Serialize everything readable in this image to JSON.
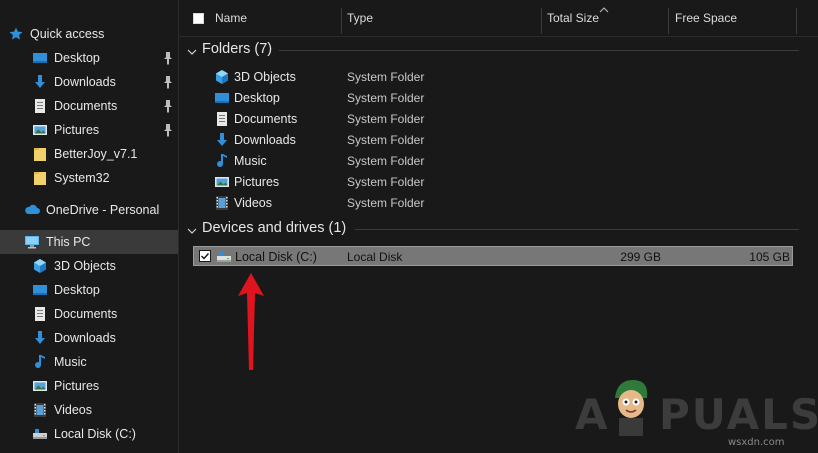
{
  "sidebar": {
    "quick_access": "Quick access",
    "quick_items": [
      {
        "label": "Desktop",
        "icon": "desktop-icon",
        "pinned": true
      },
      {
        "label": "Downloads",
        "icon": "downloads-icon",
        "pinned": true
      },
      {
        "label": "Documents",
        "icon": "documents-icon",
        "pinned": true
      },
      {
        "label": "Pictures",
        "icon": "pictures-icon",
        "pinned": true
      },
      {
        "label": "BetterJoy_v7.1",
        "icon": "folder-icon",
        "pinned": false
      },
      {
        "label": "System32",
        "icon": "folder-icon",
        "pinned": false
      }
    ],
    "onedrive": "OneDrive - Personal",
    "this_pc": "This PC",
    "pc_items": [
      {
        "label": "3D Objects",
        "icon": "3d-objects-icon"
      },
      {
        "label": "Desktop",
        "icon": "desktop-icon"
      },
      {
        "label": "Documents",
        "icon": "documents-icon"
      },
      {
        "label": "Downloads",
        "icon": "downloads-icon"
      },
      {
        "label": "Music",
        "icon": "music-icon"
      },
      {
        "label": "Pictures",
        "icon": "pictures-icon"
      },
      {
        "label": "Videos",
        "icon": "videos-icon"
      },
      {
        "label": "Local Disk (C:)",
        "icon": "local-disk-icon"
      }
    ]
  },
  "columns": {
    "name": "Name",
    "type": "Type",
    "total_size": "Total Size",
    "free_space": "Free Space"
  },
  "folders_group": "Folders (7)",
  "folders": [
    {
      "name": "3D Objects",
      "type": "System Folder",
      "icon": "3d-objects-icon"
    },
    {
      "name": "Desktop",
      "type": "System Folder",
      "icon": "desktop-icon"
    },
    {
      "name": "Documents",
      "type": "System Folder",
      "icon": "documents-icon"
    },
    {
      "name": "Downloads",
      "type": "System Folder",
      "icon": "downloads-icon"
    },
    {
      "name": "Music",
      "type": "System Folder",
      "icon": "music-icon"
    },
    {
      "name": "Pictures",
      "type": "System Folder",
      "icon": "pictures-icon"
    },
    {
      "name": "Videos",
      "type": "System Folder",
      "icon": "videos-icon"
    }
  ],
  "drives_group": "Devices and drives (1)",
  "drive": {
    "name": "Local Disk (C:)",
    "type": "Local Disk",
    "total_size": "299 GB",
    "free_space": "105 GB",
    "checked": true
  },
  "watermark": {
    "left": "A",
    "right": "PUALS"
  },
  "site": "wsxdn.com",
  "colors": {
    "background": "#191919",
    "selected_row": "#777777",
    "folder_blue": "#2f8fd8",
    "folder_yellow": "#f2d06b",
    "arrow_red": "#e0141e"
  }
}
